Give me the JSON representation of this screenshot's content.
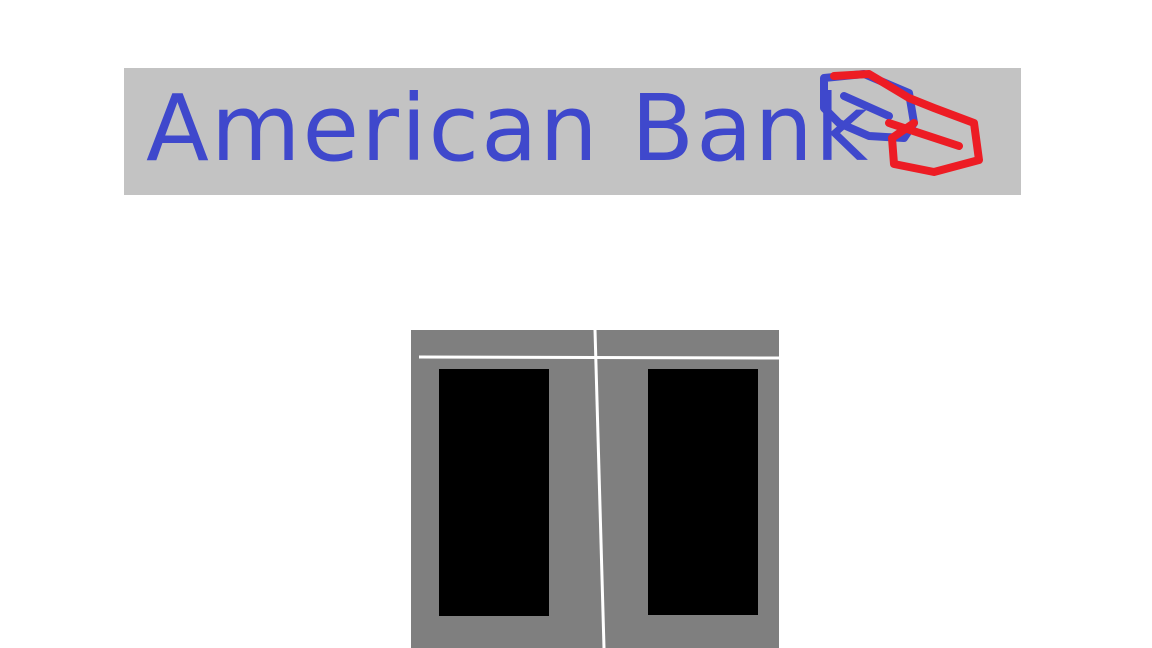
{
  "sign": {
    "text": "American Bank",
    "text_color": "#3f48cc",
    "background_color": "#c3c3c3",
    "logo": "blue-red-hexagon-chain-icon",
    "logo_colors": [
      "#3f48cc",
      "#ed1c24"
    ]
  },
  "building": {
    "wall_color": "#7f7f7f",
    "door_color": "#000000",
    "frame_line_color": "#ffffff",
    "doors": [
      "left",
      "right"
    ]
  }
}
